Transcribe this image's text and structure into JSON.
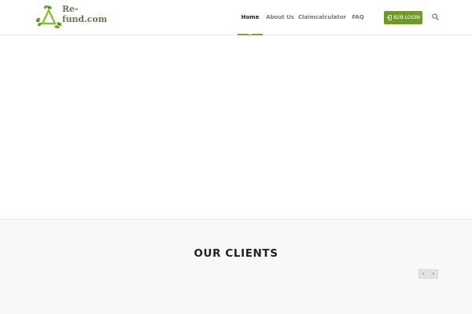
{
  "brand": {
    "name": "Re-fund.com",
    "accent_color": "#7aa33a",
    "logo_icon": "recycle-leaf-icon"
  },
  "nav": {
    "items": [
      {
        "label": "Home",
        "active": true
      },
      {
        "label": "About Us",
        "active": false
      },
      {
        "label": "Claimcalculator",
        "active": false
      },
      {
        "label": "FAQ",
        "active": false
      }
    ],
    "login_button": {
      "label": "B2B LOGIN",
      "icon": "sign-in-icon",
      "color": "#6f9a2a"
    },
    "search_icon": "search-icon"
  },
  "clients": {
    "title": "OUR CLIENTS",
    "prev_label": "‹",
    "next_label": "›"
  }
}
